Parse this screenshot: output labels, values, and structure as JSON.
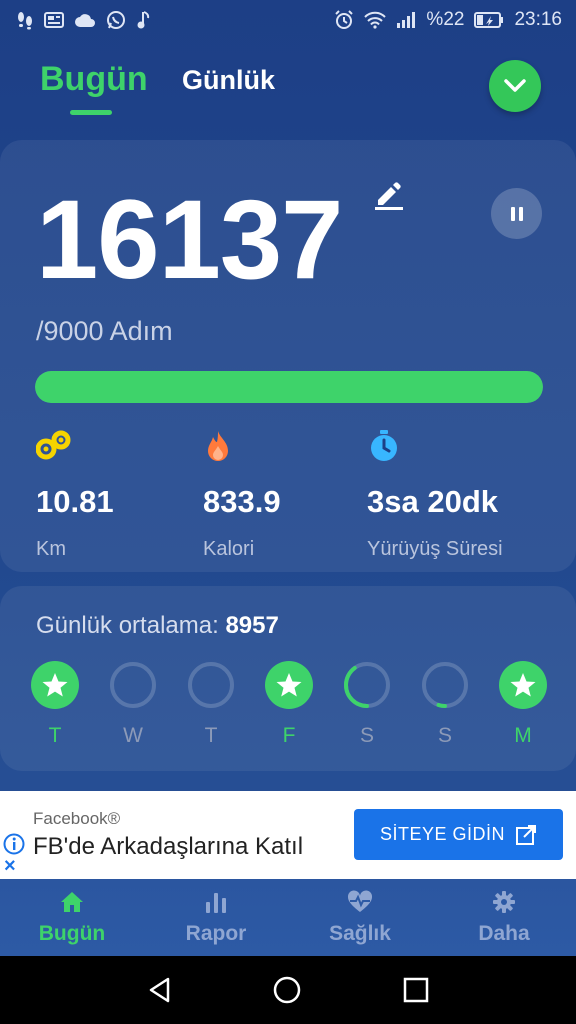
{
  "status_bar": {
    "battery_percent": "%22",
    "time": "23:16",
    "left_icons": [
      "footsteps-icon",
      "news-icon",
      "cloud-icon",
      "whatsapp-icon",
      "music-note-icon"
    ],
    "right_icons": [
      "alarm-icon",
      "wifi-icon",
      "signal-icon",
      "battery-icon"
    ]
  },
  "top_tabs": {
    "today": "Bugün",
    "daily": "Günlük",
    "active": "today"
  },
  "steps": {
    "count": "16137",
    "goal_text": "/9000 Adım",
    "progress": 1.0,
    "accent_color": "#3ed36a"
  },
  "stats": [
    {
      "icon": "distance-icon",
      "value": "10.81",
      "label": "Km",
      "color": "#f5d400"
    },
    {
      "icon": "flame-icon",
      "value": "833.9",
      "label": "Kalori",
      "color": "#ff7a3c"
    },
    {
      "icon": "stopwatch-icon",
      "value": "3sa 20dk",
      "label": "Yürüyüş Süresi",
      "color": "#38b6ff"
    }
  ],
  "weekly": {
    "avg_label": "Günlük ortalama:",
    "avg_value": "8957",
    "days": [
      {
        "letter": "T",
        "state": "complete",
        "progress": 1.0
      },
      {
        "letter": "W",
        "state": "empty",
        "progress": 0
      },
      {
        "letter": "T",
        "state": "empty",
        "progress": 0
      },
      {
        "letter": "F",
        "state": "complete",
        "progress": 1.0
      },
      {
        "letter": "S",
        "state": "partial",
        "progress": 0.4
      },
      {
        "letter": "S",
        "state": "partial",
        "progress": 0.05
      },
      {
        "letter": "M",
        "state": "complete",
        "progress": 1.0
      }
    ]
  },
  "ad": {
    "sponsor": "Facebook®",
    "title": "FB'de Arkadaşlarına Katıl",
    "cta": "SİTEYE GİDİN",
    "close": "×"
  },
  "bottom_nav": [
    {
      "icon": "home-icon",
      "label": "Bugün",
      "active": true
    },
    {
      "icon": "bar-chart-icon",
      "label": "Rapor",
      "active": false
    },
    {
      "icon": "heart-pulse-icon",
      "label": "Sağlık",
      "active": false
    },
    {
      "icon": "gear-icon",
      "label": "Daha",
      "active": false
    }
  ]
}
